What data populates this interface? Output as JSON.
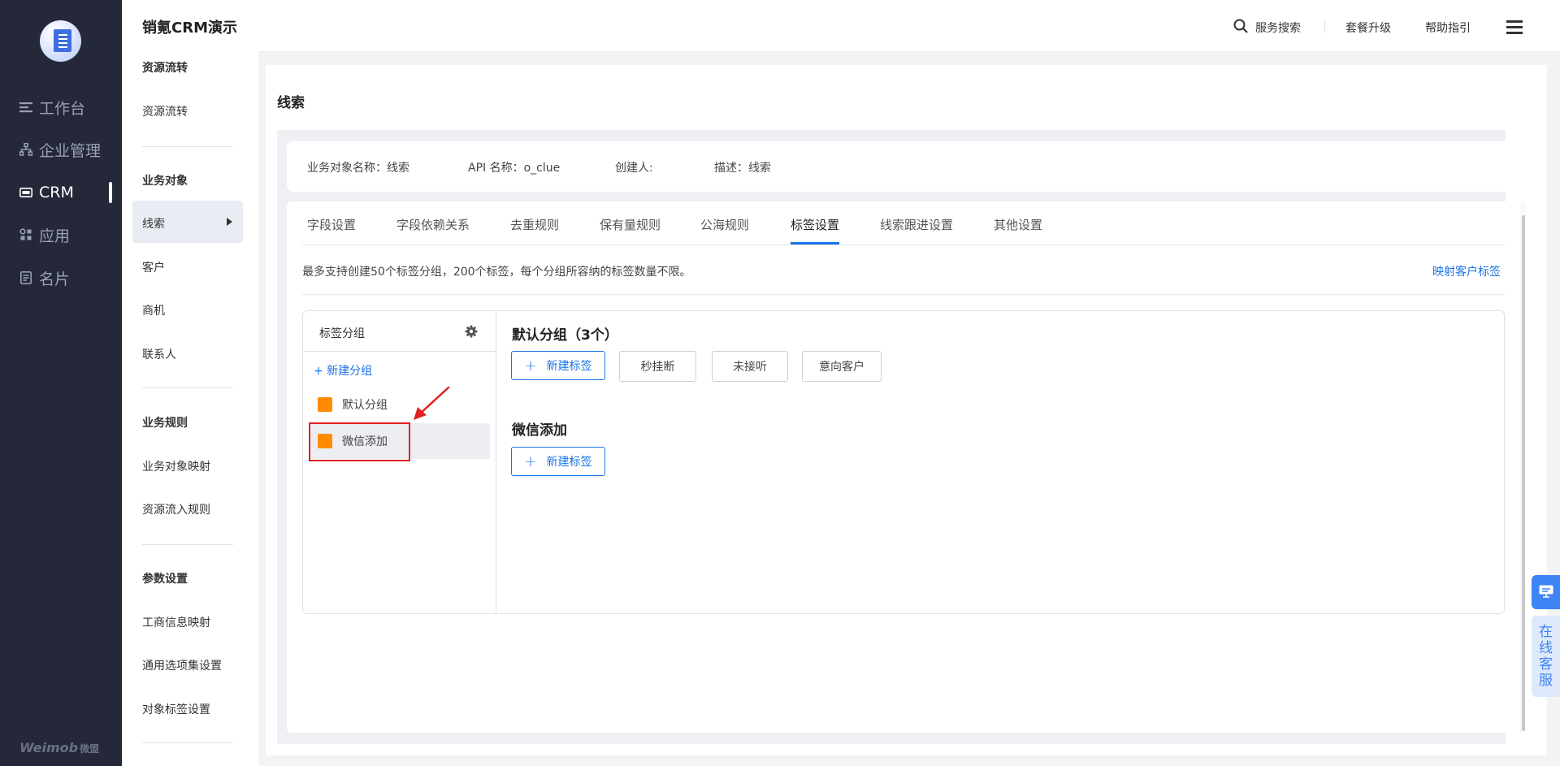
{
  "nav": {
    "items": [
      {
        "label": "工作台",
        "icon": "workbench-icon"
      },
      {
        "label": "企业管理",
        "icon": "org-chart-icon"
      },
      {
        "label": "CRM",
        "icon": "crm-icon"
      },
      {
        "label": "应用",
        "icon": "apps-icon"
      },
      {
        "label": "名片",
        "icon": "card-icon"
      }
    ],
    "active": "CRM",
    "footer_logo": "Weimob",
    "footer_logo_cn": "微盟"
  },
  "app": {
    "title": "销氪CRM演示"
  },
  "sidebar": {
    "sections": [
      {
        "title": "资源流转",
        "items": [
          "资源流转"
        ]
      },
      {
        "title": "业务对象",
        "items": [
          "线索",
          "客户",
          "商机",
          "联系人"
        ]
      },
      {
        "title": "业务规则",
        "items": [
          "业务对象映射",
          "资源流入规则"
        ]
      },
      {
        "title": "参数设置",
        "items": [
          "工商信息映射",
          "通用选项集设置",
          "对象标签设置"
        ]
      }
    ],
    "active_item": "线索"
  },
  "topbar": {
    "search": "服务搜索",
    "upgrade": "套餐升级",
    "help": "帮助指引"
  },
  "page": {
    "title": "线索",
    "info": {
      "object_name": "业务对象名称：线索",
      "api_name": "API 名称：o_clue",
      "creator": "创建人:",
      "description": "描述：线索"
    },
    "tabs": [
      "字段设置",
      "字段依赖关系",
      "去重规则",
      "保有量规则",
      "公海规则",
      "标签设置",
      "线索跟进设置",
      "其他设置"
    ],
    "active_tab": "标签设置",
    "hint": "最多支持创建50个标签分组，200个标签，每个分组所容纳的标签数量不限。",
    "map_link": "映射客户标签",
    "groups_panel": {
      "title": "标签分组",
      "new_group": "+ 新建分组",
      "groups": [
        "默认分组",
        "微信添加"
      ],
      "selected": "微信添加"
    },
    "sections": [
      {
        "title": "默认分组（3个）",
        "new_tag": "新建标签",
        "tags": [
          "秒挂断",
          "未接听",
          "意向客户"
        ]
      },
      {
        "title": "微信添加",
        "new_tag": "新建标签",
        "tags": []
      }
    ]
  },
  "float": {
    "service": [
      "在",
      "线",
      "客",
      "服"
    ]
  },
  "colors": {
    "accent": "#1a73e8",
    "nav_bg": "#242838",
    "group_square": "#ff8c00",
    "highlight": "#e02222"
  }
}
